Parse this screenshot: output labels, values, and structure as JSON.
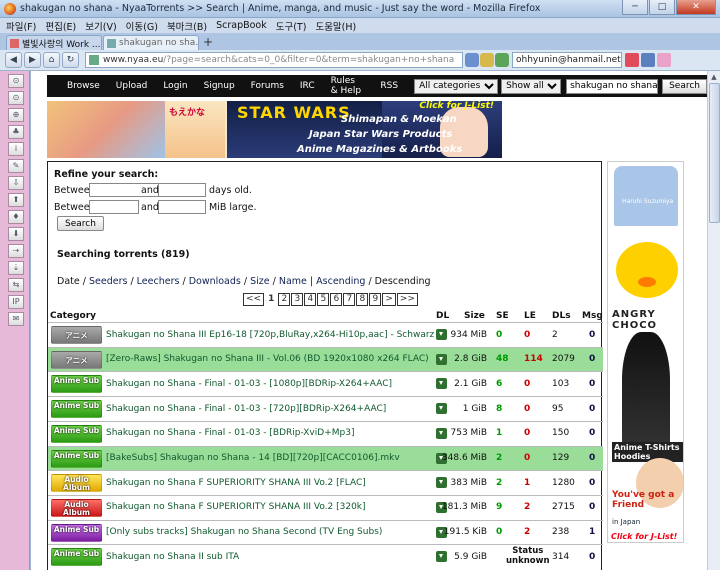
{
  "window": {
    "title": "shakugan no shana - NyaaTorrents >> Search | Anime, manga, and music - Just say the word - Mozilla Firefox (Build 20120420145725)",
    "minimize": "─",
    "maximize": "□",
    "close": "✕"
  },
  "menu": [
    "파일(F)",
    "편집(E)",
    "보기(V)",
    "이동(G)",
    "북마크(B)",
    "ScrapBook",
    "도구(T)",
    "도움말(H)"
  ],
  "tabs": [
    {
      "label": "별빛사랑의 Work ...",
      "active": false
    },
    {
      "label": "shakugan no sha...",
      "active": true
    }
  ],
  "new_tab": "+",
  "nav": {
    "back": "◀",
    "forward": "▶",
    "home": "⌂",
    "reload": "↻",
    "url_host": "www.nyaa.eu",
    "url_path": "/?page=search&cats=0_0&filter=0&term=shakugan+no+shana",
    "email": "ohhyunin@hanmail.net"
  },
  "sidebar_icons": [
    "⊙",
    "⊙",
    "⊕",
    "♣",
    "i",
    "✎",
    "⇩",
    "⬆",
    "♦",
    "⬇",
    "⇢",
    "⇣",
    "⇆",
    "IP",
    "✉"
  ],
  "site_nav": {
    "links": [
      "Browse",
      "Upload",
      "Login",
      "Signup",
      "Forums",
      "IRC",
      "Rules & Help",
      "RSS"
    ],
    "category": "All categories",
    "filter": "Show all",
    "search_value": "shakugan no shana",
    "search_button": "Search"
  },
  "banner": {
    "moekan": "もえかな",
    "star_wars": "STAR WARS",
    "cta": "Click for J-List!",
    "line1": "Shimapan & Moekan",
    "line2": "Japan Star Wars Products",
    "line3": "Anime Magazines & Artbooks"
  },
  "refine": {
    "title": "Refine your search:",
    "between": "Between",
    "and": "and",
    "days_old": "days old.",
    "mib_large": "MiB large.",
    "search_button": "Search"
  },
  "results_count": "Searching torrents (819)",
  "sort": {
    "date": "Date",
    "options": [
      "Seeders",
      "Leechers",
      "Downloads",
      "Size",
      "Name",
      "Ascending"
    ],
    "current": "Descending"
  },
  "pager": [
    "<<",
    "1",
    "2",
    "3",
    "4",
    "5",
    "6",
    "7",
    "8",
    "9",
    ">",
    ">>"
  ],
  "table_headers": {
    "category": "Category",
    "dl": "DL",
    "size": "Size",
    "se": "SE",
    "le": "LE",
    "dls": "DLs",
    "msg": "Msg"
  },
  "torrents": [
    {
      "badge": "アニメ",
      "badge_color": "gray",
      "name": "Shakugan no Shana III Ep16-18 [720p,BluRay,x264-Hi10p,aac] - Schwarz",
      "size": "934 MiB",
      "se": "0",
      "le": "0",
      "dls": "2",
      "msg": "0",
      "row_color": "white"
    },
    {
      "badge": "アニメ",
      "badge_color": "gray",
      "name": "[Zero-Raws] Shakugan no Shana III - Vol.06 (BD 1920x1080 x264 FLAC)",
      "size": "2.8 GiB",
      "se": "48",
      "le": "114",
      "dls": "2079",
      "msg": "0",
      "row_color": "green"
    },
    {
      "badge": "Anime Sub",
      "badge_color": "green",
      "name": "Shakugan no Shana - Final - 01-03 - [1080p][BDRip-X264+AAC]",
      "size": "2.1 GiB",
      "se": "6",
      "le": "0",
      "dls": "103",
      "msg": "0",
      "row_color": "white"
    },
    {
      "badge": "Anime Sub",
      "badge_color": "green",
      "name": "Shakugan no Shana - Final - 01-03 - [720p][BDRip-X264+AAC]",
      "size": "1 GiB",
      "se": "8",
      "le": "0",
      "dls": "95",
      "msg": "0",
      "row_color": "white"
    },
    {
      "badge": "Anime Sub",
      "badge_color": "green",
      "name": "Shakugan no Shana - Final - 01-03 - [BDRip-XviD+Mp3]",
      "size": "753 MiB",
      "se": "1",
      "le": "0",
      "dls": "150",
      "msg": "0",
      "row_color": "white"
    },
    {
      "badge": "Anime Sub",
      "badge_color": "green",
      "name": "[BakeSubs] Shakugan no Shana - 14 [BD][720p][CACC0106].mkv",
      "size": "348.6 MiB",
      "se": "2",
      "le": "0",
      "dls": "129",
      "msg": "0",
      "row_color": "green"
    },
    {
      "badge": "Audio Album",
      "badge_color": "yellow",
      "name": "Shakugan no Shana F SUPERIORITY SHANA III Vo.2 [FLAC]",
      "size": "383 MiB",
      "se": "2",
      "le": "1",
      "dls": "1280",
      "msg": "0",
      "row_color": "white"
    },
    {
      "badge": "Audio Album",
      "badge_color": "red",
      "name": "Shakugan no Shana F SUPERIORITY SHANA III Vo.2 [320k]",
      "size": "181.3 MiB",
      "se": "9",
      "le": "2",
      "dls": "2715",
      "msg": "0",
      "row_color": "white"
    },
    {
      "badge": "Anime Sub",
      "badge_color": "purple",
      "name": "[Only subs tracks] Shakugan no Shana Second (TV Eng Subs)",
      "size": "191.5 KiB",
      "se": "0",
      "le": "2",
      "dls": "238",
      "msg": "1",
      "row_color": "white"
    },
    {
      "badge": "Anime Sub",
      "badge_color": "green",
      "name": "Shakugan no Shana II sub ITA",
      "size": "5.9 GiB",
      "status_line1": "Status",
      "status_line2": "unknown",
      "dls": "314",
      "msg": "0",
      "row_color": "white"
    }
  ],
  "right_ad": {
    "shirt_text": "Haruhi Suzumiya",
    "angry": "ANGRY CHOCO",
    "hoodies": "Anime T-Shirts Hoodies",
    "you_got": "You've got a Friend",
    "in_japan": "in Japan",
    "cta": "Click for J-List!"
  }
}
